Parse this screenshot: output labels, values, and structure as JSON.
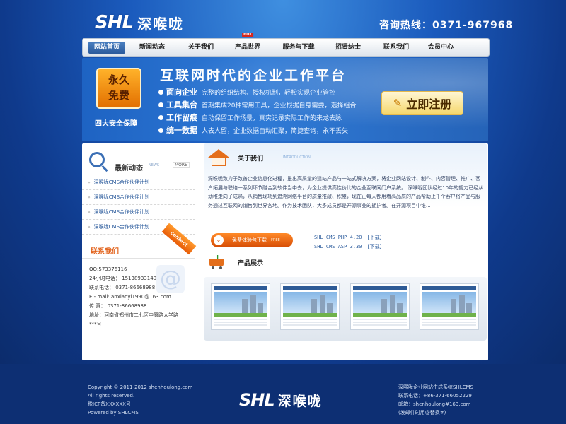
{
  "header": {
    "logo_en": "SHL",
    "logo_cn": "深喉咙",
    "hotline": "咨询热线：0371-967968"
  },
  "nav": {
    "items": [
      {
        "label": "网站首页",
        "active": true
      },
      {
        "label": "新闻动态"
      },
      {
        "label": "关于我们"
      },
      {
        "label": "产品世界",
        "badge": "HOT"
      },
      {
        "label": "服务与下载"
      },
      {
        "label": "招贤纳士"
      },
      {
        "label": "联系我们"
      },
      {
        "label": "会员中心"
      }
    ]
  },
  "banner": {
    "promo_line1": "永久",
    "promo_line2": "免费",
    "guarantee": "四大安全保障",
    "title": "互联网时代的企业工作平台",
    "features": [
      {
        "name": "面向企业",
        "desc": "完整的组织结构、授权机制，轻松实现企业管控"
      },
      {
        "name": "工具集合",
        "desc": "首期集成20种常用工具，企业根据自身需要，选择组合"
      },
      {
        "name": "工作留痕",
        "desc": "自动保留工作场景，真实记录实际工作的来龙去脉"
      },
      {
        "name": "统一数据",
        "desc": "人去人留，企业数据自动汇聚，简捷查询，永不丢失"
      }
    ],
    "register_label": "立即注册"
  },
  "sidebar": {
    "news_title": "最新动态",
    "news_en": "NEWS",
    "more_label": "MORE",
    "news_items": [
      "深喉咙CMS合作伙伴计划",
      "深喉咙CMS合作伙伴计划",
      "深喉咙CMS合作伙伴计划",
      "深喉咙CMS合作伙伴计划"
    ],
    "contact_title": "联系我们",
    "contact_tag": "contact",
    "contact_lines": [
      "QQ:573376116",
      "24小时电话： 15138933140",
      "联系电话： 0371-86668988",
      "E - mail: anxiaoyi1990@163.com",
      "传    真： 0371-86668988",
      "地址：河南省郑州市二七区中原路大学路",
      "***号"
    ]
  },
  "about": {
    "title": "关于我们",
    "en": "INTRODUCTION",
    "text": "深喉咙致力于改善企业信息化进程，推出高质量的建站产品与一站式解决方案，将企业网站设计、制作、内容管理、推广、客户拓展与联络一系列环节融合到软件当中去，为企业提供高性价比的企业互联网门户系统。    深喉咙团队经过10年的努力已经从幼稚走向了成熟，从销售现场到追溯网络平台的质量推敲、积累，现在正每天都用着高品质的产品帮助上千个客户将产品与服务通过互联网的销售到世界各地。作为技术团队，大多成员都是开源事业的拥护者。在开源项目中谁...",
    "download_label": "免费体验包下载",
    "download_small": "FREE",
    "links": [
      {
        "name": "SHL CMS PHP 4.20",
        "action": "【下载】"
      },
      {
        "name": "SHL CMS ASP 3.30",
        "action": "【下载】"
      }
    ]
  },
  "products": {
    "title": "产品展示",
    "count": 4
  },
  "footer": {
    "left_lines": [
      "Copyright © 2011-2012 shenhoulong.com",
      "All rights reserved.",
      "豫ICP备XXXXXX号",
      "Powered by SHLCMS"
    ],
    "right_lines": [
      "深喉咙企业网站生成系统SHLCMS",
      "联系电话：+86-371-66052229",
      "邮箱：shenhoulong#163.com",
      "(发邮件时用@替换#)"
    ]
  },
  "colors": {
    "accent_orange": "#e46f1c",
    "nav_active": "#2b5b9c",
    "footer_bg": "#0d2f73"
  }
}
